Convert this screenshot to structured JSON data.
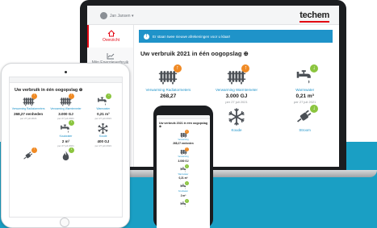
{
  "colors": {
    "brand_red": "#e30613",
    "accent_blue": "#1f93c9",
    "band_blue": "#1a9fc4",
    "badge_orange": "#f08a24",
    "badge_green": "#8bc53f"
  },
  "laptop": {
    "user_name": "Jan Jansen ▾",
    "logo": "techem",
    "sidebar": [
      {
        "label": "Overzicht",
        "icon": "home-icon"
      },
      {
        "label": "Mijn Energieverbruik",
        "icon": "chart-icon"
      }
    ],
    "banner_text": "Er staan twee nieuwe afrekeningen voor u klaar!",
    "title": "Uw verbruik 2021 in één oogopslag ⊕",
    "tiles": [
      {
        "icon": "radiator-icon",
        "badge": "↑",
        "label": "Verwarming Radiatormeters",
        "value": "268,27",
        "date": ""
      },
      {
        "icon": "radiator-icon",
        "badge": "↑",
        "label": "Verwarming Warmtemeter",
        "value": "3.000 GJ",
        "date": "per 27 juli 2021"
      },
      {
        "icon": "water-tap-icon",
        "badge": "↓",
        "label": "Warmwater",
        "value": "0,21 m³",
        "date": "per 27 juli 2021"
      },
      {
        "icon": "",
        "badge": "",
        "label": "",
        "value": "",
        "date": ""
      },
      {
        "icon": "snowflake-icon",
        "badge": "",
        "label": "Koude",
        "value": "",
        "date": ""
      },
      {
        "icon": "power-plug-icon",
        "badge": "↓",
        "label": "Stroom",
        "value": "",
        "date": ""
      }
    ]
  },
  "tablet": {
    "title": "Uw verbruik in één oogopslag ⊕",
    "tiles": [
      {
        "icon": "radiator-icon",
        "badge": "↑",
        "label": "Verwarming Radiatormeters",
        "value": "268,27 eenheden",
        "date": "per 27 juli 2021"
      },
      {
        "icon": "radiator-icon",
        "badge": "↑",
        "label": "Verwarming Warmtemeter",
        "value": "3.000 GJ",
        "date": "per 27 juli 2021"
      },
      {
        "icon": "water-tap-icon",
        "badge": "↓",
        "label": "Warmwater",
        "value": "0,21 m³",
        "date": "per 27 juli 2021"
      },
      {
        "icon": "",
        "badge": "",
        "label": "",
        "value": "",
        "date": ""
      },
      {
        "icon": "water-tap-icon",
        "badge": "↓",
        "label": "Koudwater",
        "value": "2 m³",
        "date": "per 27 juli 2021"
      },
      {
        "icon": "snowflake-icon",
        "badge": "",
        "label": "Koude",
        "value": "400 GJ",
        "date": "per 27 juli 2021"
      },
      {
        "icon": "power-plug-icon",
        "badge": "↑",
        "label": "",
        "value": "",
        "date": ""
      },
      {
        "icon": "flame-icon",
        "badge": "↓",
        "label": "",
        "value": "",
        "date": ""
      },
      {
        "icon": "",
        "badge": "",
        "label": "",
        "value": "",
        "date": ""
      }
    ]
  },
  "phone": {
    "title": "Uw verbruik 2021 in één oogopslag ⊕",
    "tiles": [
      {
        "icon": "radiator-icon",
        "badge": "↑",
        "label": "Verwarming",
        "value": "268,27 eenheden",
        "date": ""
      },
      {
        "icon": "radiator-icon",
        "badge": "↑",
        "label": "Verwarming",
        "value": "3.000 GJ",
        "date": ""
      },
      {
        "icon": "water-tap-icon",
        "badge": "↓",
        "label": "Warmwater",
        "value": "0,21 m³",
        "date": ""
      },
      {
        "icon": "water-tap-icon",
        "badge": "↓",
        "label": "Koudwater",
        "value": "2 m³",
        "date": ""
      },
      {
        "icon": "water-tap-icon",
        "badge": "↓",
        "label": "",
        "value": "",
        "date": ""
      }
    ]
  }
}
